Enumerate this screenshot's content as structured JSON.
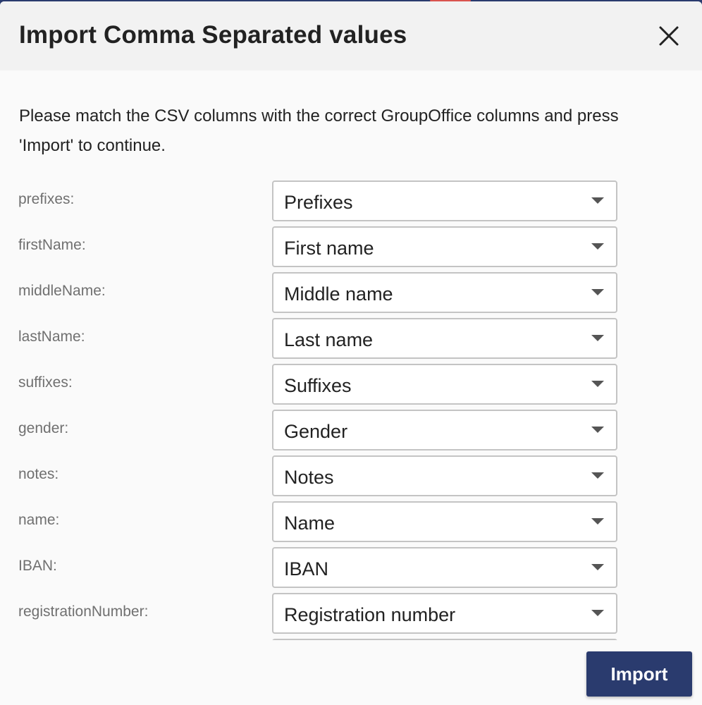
{
  "dialog": {
    "title": "Import Comma Separated values",
    "intro": "Please match the CSV columns with the correct GroupOffice columns and press 'Import' to continue."
  },
  "mappings": [
    {
      "label": "prefixes:",
      "value": "Prefixes"
    },
    {
      "label": "firstName:",
      "value": "First name"
    },
    {
      "label": "middleName:",
      "value": "Middle name"
    },
    {
      "label": "lastName:",
      "value": "Last name"
    },
    {
      "label": "suffixes:",
      "value": "Suffixes"
    },
    {
      "label": "gender:",
      "value": "Gender"
    },
    {
      "label": "notes:",
      "value": "Notes"
    },
    {
      "label": "name:",
      "value": "Name"
    },
    {
      "label": "IBAN:",
      "value": "IBAN"
    },
    {
      "label": "registrationNumber:",
      "value": "Registration number"
    }
  ],
  "footer": {
    "import_label": "Import"
  },
  "icons": {
    "close": "close-icon",
    "dropdown": "chevron-down-icon"
  },
  "colors": {
    "primary": "#2a3b6e",
    "header_bg": "#f2f2f2",
    "body_bg": "#fafafa",
    "label_text": "#707070",
    "border": "#c4c4c4"
  }
}
